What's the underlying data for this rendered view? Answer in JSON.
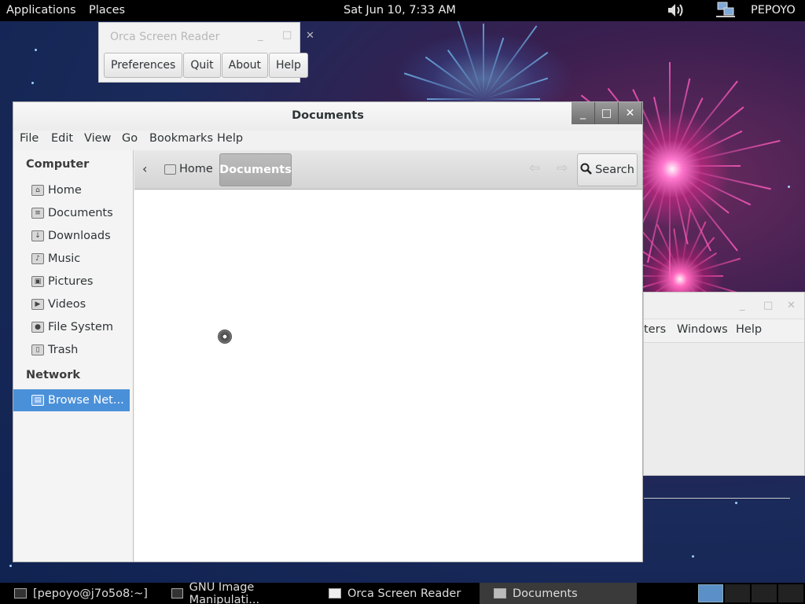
{
  "top_panel": {
    "applications": "Applications",
    "places": "Places",
    "clock": "Sat Jun 10,  7:33 AM",
    "volume_icon": "speaker-icon",
    "network_icon": "network-icon",
    "user": "PEPOYO"
  },
  "orca": {
    "title": "Orca Screen Reader",
    "buttons": [
      "Preferences",
      "Quit",
      "About",
      "Help"
    ]
  },
  "bg_window": {
    "menu": [
      "ters",
      "Windows",
      "Help"
    ]
  },
  "documents": {
    "title": "Documents",
    "menu": [
      "File",
      "Edit",
      "View",
      "Go",
      "Bookmarks",
      "Help"
    ],
    "sidebar": {
      "computer_header": "Computer",
      "computer_items": [
        "Home",
        "Documents",
        "Downloads",
        "Music",
        "Pictures",
        "Videos",
        "File System",
        "Trash"
      ],
      "network_header": "Network",
      "network_items": [
        "Browse Net..."
      ]
    },
    "path": {
      "home": "Home",
      "current": "Documents"
    },
    "search_label": "Search"
  },
  "bottom_panel": {
    "tasks": [
      "[pepoyo@j7o5o8:~]",
      "GNU Image Manipulati...",
      "Orca Screen Reader",
      "Documents"
    ],
    "active_task": "Documents"
  }
}
